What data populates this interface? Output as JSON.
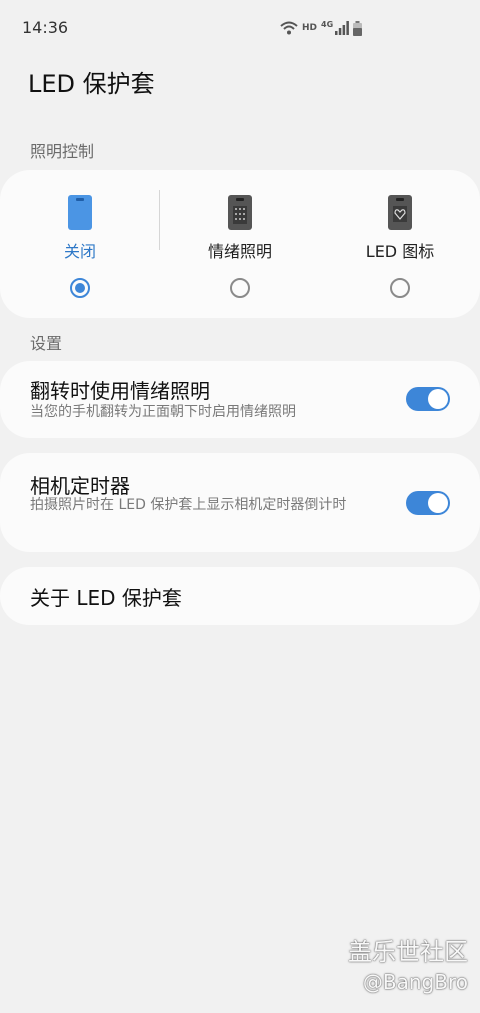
{
  "status_bar": {
    "time": "14:36",
    "hd_label": "HD",
    "network_label": "4G"
  },
  "header": {
    "title": "LED 保护套"
  },
  "lighting": {
    "section_label": "照明控制",
    "options": [
      {
        "label": "关闭",
        "selected": true,
        "label_color": "#2e78c7"
      },
      {
        "label": "情绪照明",
        "selected": false
      },
      {
        "label": "LED 图标",
        "selected": false
      }
    ]
  },
  "settings": {
    "section_label": "设置",
    "items": [
      {
        "title": "翻转时使用情绪照明",
        "description": "当您的手机翻转为正面朝下时启用情绪照明",
        "enabled": true
      },
      {
        "title": "相机定时器",
        "description": "拍摄照片时在 LED 保护套上显示相机定时器倒计时",
        "enabled": true
      }
    ]
  },
  "about": {
    "label": "关于 LED 保护套"
  },
  "watermark": {
    "line1": "盖乐世社区",
    "line2": "@BangBro"
  },
  "colors": {
    "accent": "#3d86d8",
    "background": "#f1f1f1",
    "card": "#fbfbfb"
  }
}
